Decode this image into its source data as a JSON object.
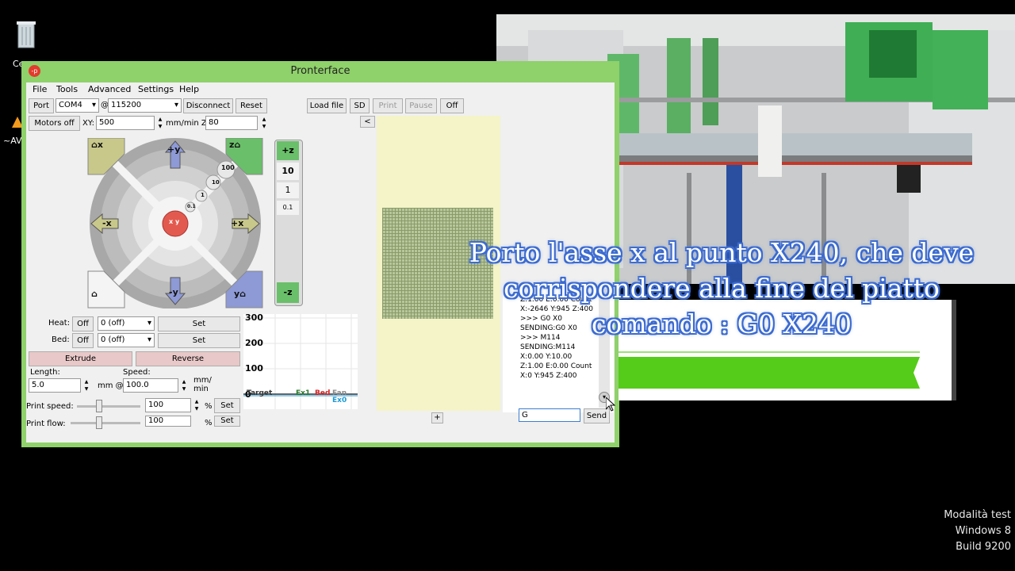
{
  "desktop": {
    "icons": [
      {
        "label": "Ce"
      },
      {
        "label": "~AV"
      }
    ],
    "watermark": [
      "Modalità test",
      "Windows 8",
      "Build 9200"
    ]
  },
  "window": {
    "title": "Pronterface",
    "app_icon": "-p",
    "menu": [
      "File",
      "Tools",
      "Advanced",
      "Settings",
      "Help"
    ]
  },
  "toolbar": {
    "port_button": "Port",
    "port_value": "COM4",
    "at": "@",
    "baud_value": "115200",
    "disconnect": "Disconnect",
    "reset": "Reset",
    "load_file": "Load file",
    "sd": "SD",
    "print": "Print",
    "pause": "Pause",
    "off": "Off",
    "collapse": "<"
  },
  "motion": {
    "motors_off": "Motors off",
    "xy_label": "XY:",
    "xy_value": "500",
    "units_z": "mm/min Z:",
    "z_value": "80"
  },
  "jog": {
    "home_x": "x",
    "plus_y": "+y",
    "home_z": "z",
    "minus_x": "-x",
    "plus_x": "+x",
    "minus_y": "-y",
    "home_y": "y",
    "steps": [
      "100",
      "10",
      "1",
      "0.1"
    ],
    "z_plus": "+z",
    "z_minus": "-z",
    "z_steps": [
      "10",
      "1",
      "0.1"
    ],
    "center": "x y"
  },
  "temps": {
    "heat_label": "Heat:",
    "heat_off": "Off",
    "heat_value": "0 (off)",
    "heat_set": "Set",
    "bed_label": "Bed:",
    "bed_off": "Off",
    "bed_value": "0 (off)",
    "bed_set": "Set"
  },
  "extrude": {
    "extrude": "Extrude",
    "reverse": "Reverse",
    "length_label": "Length:",
    "length_value": "5.0",
    "mm_at": "mm @",
    "speed_label": "Speed:",
    "speed_value": "100.0",
    "mm_min": "mm/\nmin",
    "print_speed_label": "Print speed:",
    "print_speed_value": "100",
    "pct": "%",
    "print_speed_set": "Set",
    "print_flow_label": "Print flow:",
    "print_flow_value": "100",
    "pct2": "%",
    "print_flow_set": "Set"
  },
  "graph": {
    "y_ticks": [
      "300",
      "200",
      "100",
      "0"
    ],
    "legend": [
      "Target",
      "Ex1",
      "Bed",
      "Fan",
      "Ex0"
    ],
    "colors": {
      "target": "#333333",
      "ex1": "#2a7a2a",
      "bed": "#d62020",
      "fan": "#888888",
      "ex0": "#1f9ad6"
    }
  },
  "plus_button": "+",
  "log": [
    "Z:1.00 E:0.00 Count",
    "X:-2646 Y:945 Z:400",
    ">>> G0 X0",
    "SENDING:G0 X0",
    ">>> M114",
    "SENDING:M114",
    "X:0.00 Y:10.00",
    "Z:1.00 E:0.00 Count",
    "X:0 Y:945 Z:400"
  ],
  "command": {
    "value": "G",
    "send": "Send"
  },
  "caption": [
    "Porto l'asse x al punto X240, che deve",
    "corrispondere alla fine  del piatto",
    "comando : G0 X240"
  ]
}
